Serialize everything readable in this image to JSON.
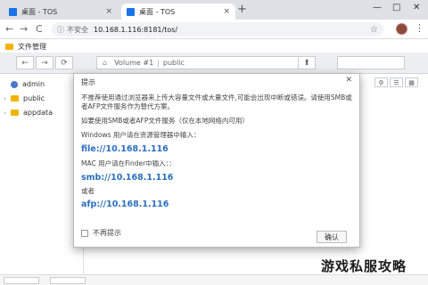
{
  "browser": {
    "tabs": [
      {
        "label": "桌面 - TOS",
        "close": "×"
      },
      {
        "label": "桌面 - TOS",
        "close": "×"
      }
    ],
    "new_tab": "+",
    "win_minimize": "—",
    "win_maximize": "□",
    "win_close": "✕",
    "back": "←",
    "forward": "→",
    "reload": "C",
    "security_text": "不安全",
    "url": "10.168.1.116:8181/tos/",
    "star": "☆",
    "menu": "⋮"
  },
  "app": {
    "title": "文件管理"
  },
  "toolbar": {
    "back": "←",
    "forward": "→",
    "refresh": "⟳",
    "home": "⌂",
    "path": [
      "Volume #1",
      "public"
    ],
    "path_sep": "|",
    "up": "⬆",
    "search_placeholder": ""
  },
  "sidebar": {
    "items": [
      {
        "label": "admin",
        "chev": "",
        "icon": "user-icon"
      },
      {
        "label": "public",
        "chev": "›",
        "icon": "folder-icon"
      },
      {
        "label": "appdata",
        "chev": "›",
        "icon": "folder-icon"
      }
    ]
  },
  "view_buttons": [
    "⚙",
    "☰",
    "▦"
  ],
  "dialog": {
    "title": "提示",
    "close": "✕",
    "warning": "不推荐使用通过浏览器来上传大容量文件或大量文件,可能会出现中断或错误。请使用SMB或者AFP文件服务作为替代方案。",
    "intro": "如要使用SMB或者AFP文件服务（仅在本地网络内可用）",
    "windows_label": "Windows 用户请在资源管理器中输入：",
    "windows_link": "file://10.168.1.116",
    "mac_label": "MAC 用户请在Finder中输入：：",
    "smb_link": "smb://10.168.1.116",
    "or_label": "或者",
    "afp_link": "afp://10.168.1.116",
    "checkbox_label": "不再提示",
    "ok_label": "确认"
  },
  "watermark": "游戏私服攻略"
}
